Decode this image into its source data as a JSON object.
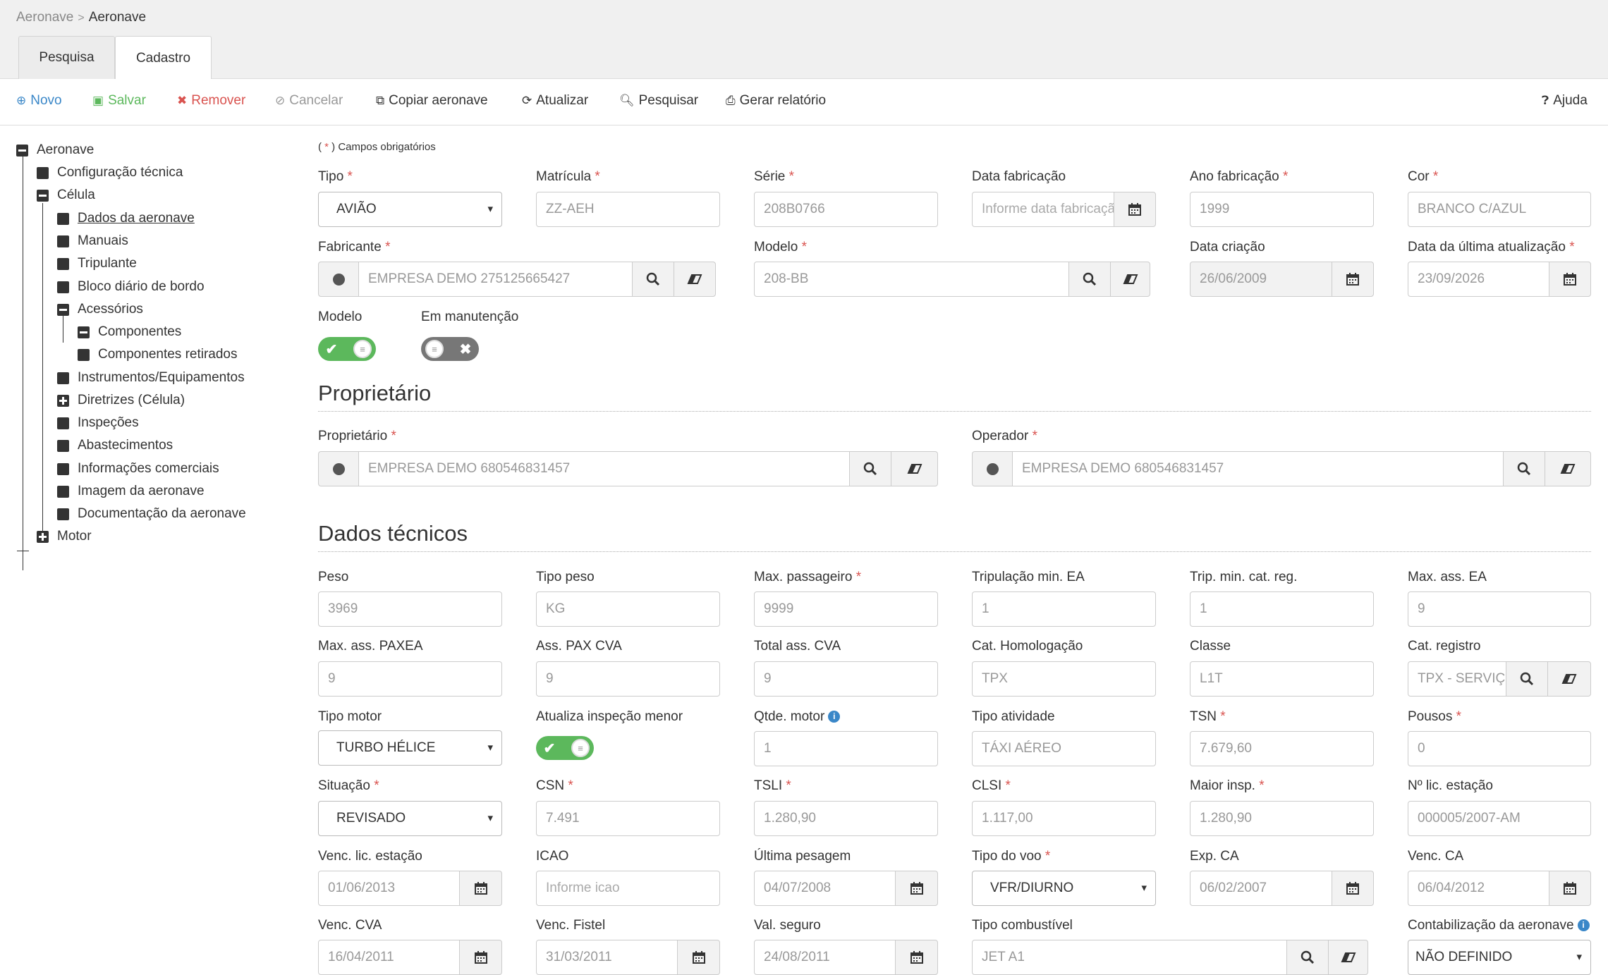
{
  "breadcrumb": {
    "parent": "Aeronave",
    "current": "Aeronave"
  },
  "tabs": [
    {
      "label": "Pesquisa"
    },
    {
      "label": "Cadastro"
    }
  ],
  "toolbar": {
    "novo": "Novo",
    "salvar": "Salvar",
    "remover": "Remover",
    "cancelar": "Cancelar",
    "copiar": "Copiar aeronave",
    "atualizar": "Atualizar",
    "pesquisar": "Pesquisar",
    "relatorio": "Gerar relatório",
    "ajuda": "Ajuda",
    "colors": {
      "novo": "#3a87c8",
      "salvar": "#5cb85c",
      "remover": "#d9534f",
      "cancelar": "#999999"
    }
  },
  "tree": {
    "root": "Aeronave",
    "items": [
      "Configuração técnica",
      "Célula",
      "Dados da aeronave",
      "Manuais",
      "Tripulante",
      "Bloco diário de bordo",
      "Acessórios",
      "Componentes",
      "Componentes retirados",
      "Instrumentos/Equipamentos",
      "Diretrizes (Célula)",
      "Inspeções",
      "Abastecimentos",
      "Informações comerciais",
      "Imagem da aeronave",
      "Documentação da aeronave",
      "Motor"
    ]
  },
  "form": {
    "required_note_pre": "( ",
    "required_star": "*",
    "required_note_post": " ) Campos obrigatórios",
    "star": "*",
    "labels": {
      "tipo": "Tipo",
      "matricula": "Matrícula",
      "serie": "Série",
      "data_fab": "Data fabricação",
      "ano_fab": "Ano fabricação",
      "cor": "Cor",
      "fabricante": "Fabricante",
      "modelo": "Modelo",
      "data_criacao": "Data criação",
      "data_ult": "Data da última atualização",
      "modelo_toggle": "Modelo",
      "em_manut": "Em manutenção"
    },
    "values": {
      "tipo": "AVIÃO",
      "matricula": "ZZ-AEH",
      "serie": "208B0766",
      "data_fab_ph": "Informe data fabricação",
      "ano_fab": "1999",
      "cor": "BRANCO C/AZUL",
      "fabricante": "EMPRESA DEMO 275125665427",
      "modelo": "208-BB",
      "data_criacao": "26/06/2009",
      "data_ult": "23/09/2026"
    }
  },
  "proprietario": {
    "title": "Proprietário",
    "lbl_prop": "Proprietário",
    "val_prop": "EMPRESA DEMO 680546831457",
    "lbl_oper": "Operador",
    "val_oper": "EMPRESA DEMO 680546831457"
  },
  "dados": {
    "title": "Dados técnicos",
    "labels": {
      "peso": "Peso",
      "tipo_peso": "Tipo peso",
      "max_pass": "Max. passageiro",
      "trip_min_ea": "Tripulação min. EA",
      "trip_min_cat": "Trip. min. cat. reg.",
      "max_ass_ea": "Max. ass. EA",
      "max_ass_paxea": "Max. ass. PAXEA",
      "ass_pax_cva": "Ass. PAX CVA",
      "total_ass_cva": "Total ass. CVA",
      "cat_homol": "Cat. Homologação",
      "classe": "Classe",
      "cat_reg": "Cat. registro",
      "tipo_motor": "Tipo motor",
      "atualiza_insp": "Atualiza inspeção menor",
      "qtde_motor": "Qtde. motor",
      "tipo_ativ": "Tipo atividade",
      "tsn": "TSN",
      "pousos": "Pousos",
      "situacao": "Situação",
      "csn": "CSN",
      "tsli": "TSLI",
      "clsi": "CLSI",
      "maior_insp": "Maior insp.",
      "n_lic": "Nº lic. estação",
      "venc_lic": "Venc. lic. estação",
      "icao": "ICAO",
      "ult_pesagem": "Última pesagem",
      "tipo_voo": "Tipo do voo",
      "exp_ca": "Exp. CA",
      "venc_ca": "Venc. CA",
      "venc_cva": "Venc. CVA",
      "venc_fistel": "Venc. Fistel",
      "val_seguro": "Val. seguro",
      "tipo_comb": "Tipo combustível",
      "contab": "Contabilização da aeronave"
    },
    "values": {
      "peso": "3969",
      "tipo_peso": "KG",
      "max_pass": "9999",
      "trip_min_ea": "1",
      "trip_min_cat": "1",
      "max_ass_ea": "9",
      "max_ass_paxea": "9",
      "ass_pax_cva": "9",
      "total_ass_cva": "9",
      "cat_homol": "TPX",
      "classe": "L1T",
      "cat_reg": "TPX - SERVIÇO",
      "tipo_motor": "TURBO HÉLICE",
      "qtde_motor": "1",
      "tipo_ativ": "TÁXI AÉREO",
      "tsn": "7.679,60",
      "pousos": "0",
      "situacao": "REVISADO",
      "csn": "7.491",
      "tsli": "1.280,90",
      "clsi": "1.117,00",
      "maior_insp": "1.280,90",
      "n_lic": "000005/2007-AM",
      "venc_lic": "01/06/2013",
      "icao_ph": "Informe icao",
      "ult_pesagem": "04/07/2008",
      "tipo_voo": "VFR/DIURNO",
      "exp_ca": "06/02/2007",
      "venc_ca": "06/04/2012",
      "venc_cva": "16/04/2011",
      "venc_fistel": "31/03/2011",
      "val_seguro": "24/08/2011",
      "tipo_comb": "JET A1",
      "contab": "NÃO DEFINIDO"
    }
  }
}
